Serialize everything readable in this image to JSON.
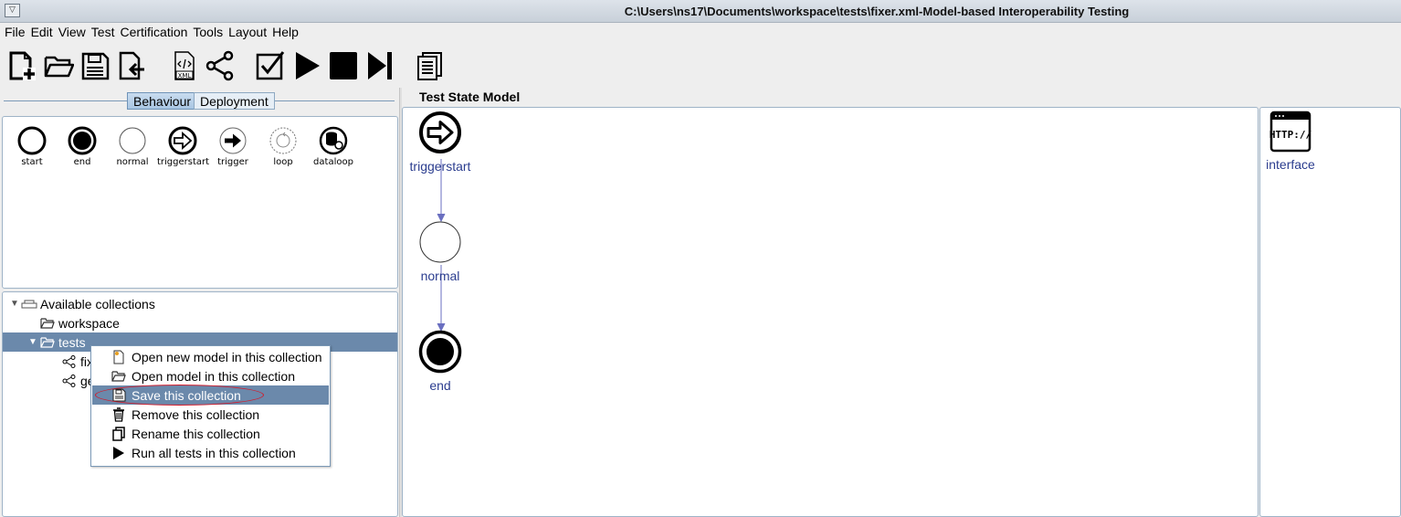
{
  "window": {
    "title": "C:\\Users\\ns17\\Documents\\workspace\\tests\\fixer.xml-Model-based Interoperability Testing"
  },
  "menu": [
    "File",
    "Edit",
    "View",
    "Test",
    "Certification",
    "Tools",
    "Layout",
    "Help"
  ],
  "toolbar": {
    "icons": [
      "new-model-icon",
      "open-folder-icon",
      "save-icon",
      "export-icon",
      "xml-icon",
      "share-graph-icon",
      "validate-check-icon",
      "run-icon",
      "stop-icon",
      "step-icon",
      "report-icon"
    ],
    "xml_label": "XML"
  },
  "tabs": {
    "behaviour": "Behaviour",
    "deployment": "Deployment",
    "active": "Behaviour"
  },
  "palette": [
    {
      "label": "start",
      "icon": "start-state-icon"
    },
    {
      "label": "end",
      "icon": "end-state-icon"
    },
    {
      "label": "normal",
      "icon": "normal-state-icon"
    },
    {
      "label": "triggerstart",
      "icon": "triggerstart-state-icon"
    },
    {
      "label": "trigger",
      "icon": "trigger-state-icon"
    },
    {
      "label": "loop",
      "icon": "loop-state-icon"
    },
    {
      "label": "dataloop",
      "icon": "dataloop-state-icon"
    }
  ],
  "tree": {
    "root": "Available collections",
    "items": [
      {
        "label": "workspace"
      },
      {
        "label": "tests",
        "selected": true
      },
      {
        "label": "fix"
      },
      {
        "label": "ge"
      }
    ]
  },
  "context_menu": {
    "items": [
      {
        "label": "Open new model in this collection",
        "icon": "new-document-icon"
      },
      {
        "label": "Open model in this collection",
        "icon": "folder-icon"
      },
      {
        "label": "Save this collection",
        "icon": "save-icon",
        "highlighted": true
      },
      {
        "label": "Remove this collection",
        "icon": "trash-icon"
      },
      {
        "label": "Rename this collection",
        "icon": "copy-icon"
      },
      {
        "label": "Run all tests in this collection",
        "icon": "play-icon"
      }
    ]
  },
  "canvas": {
    "title": "Test State Model",
    "nodes": [
      {
        "label": "triggerstart"
      },
      {
        "label": "normal"
      },
      {
        "label": "end"
      }
    ],
    "interface": {
      "label": "interface",
      "icon_text": "HTTP://"
    }
  },
  "colors": {
    "selection": "#6b89ab",
    "edge": "#6a6fc0",
    "node_label": "#2b3d8f",
    "annotation": "#d21b2b"
  }
}
